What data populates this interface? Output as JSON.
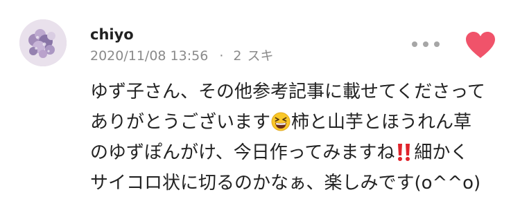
{
  "comment": {
    "author": "chiyo",
    "date": "2020/11/08 13:56",
    "separator": "·",
    "likes_count": "2",
    "likes_label": "スキ",
    "avatar_icon": "flower-avatar-icon",
    "more_icon": "more-dots-icon",
    "like_icon": "heart-icon",
    "like_color": "#f0536a",
    "body_lines": {
      "l1": "ゆず子さん、その他参考記事に載せてくださって",
      "l2a": "ありがとうございます",
      "l2_emoji": "grinning-squinting-face-emoji",
      "l2b": "柿と山芋とほうれん草",
      "l3a": "のゆずぽんがけ、今日作ってみますね",
      "l3_emoji": "double-exclamation-emoji",
      "l3b": "細かく",
      "l4": "サイコロ状に切るのかなぁ、楽しみです(o^^o)"
    }
  }
}
